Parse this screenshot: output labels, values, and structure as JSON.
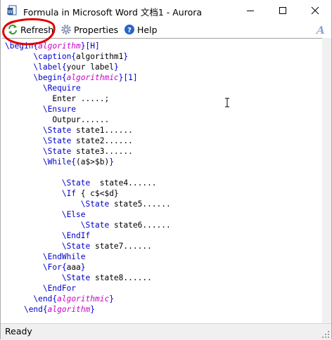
{
  "window": {
    "title": "Formula in Microsoft Word 文档1 - Aurora"
  },
  "toolbar": {
    "refresh_label": "Refresh",
    "properties_label": "Properties",
    "help_label": "Help"
  },
  "editor": {
    "lines": [
      [
        {
          "t": "kw",
          "v": "\\begin{"
        },
        {
          "t": "env",
          "v": "algorithm"
        },
        {
          "t": "kw",
          "v": "}[H]"
        }
      ],
      [
        {
          "t": "txt",
          "v": "      "
        },
        {
          "t": "kw",
          "v": "\\caption{"
        },
        {
          "t": "txt",
          "v": "algorithm1"
        },
        {
          "t": "kw",
          "v": "}"
        }
      ],
      [
        {
          "t": "txt",
          "v": "      "
        },
        {
          "t": "kw",
          "v": "\\label{"
        },
        {
          "t": "txt",
          "v": "your label"
        },
        {
          "t": "kw",
          "v": "}"
        }
      ],
      [
        {
          "t": "txt",
          "v": "      "
        },
        {
          "t": "kw",
          "v": "\\begin{"
        },
        {
          "t": "env",
          "v": "algorithmic"
        },
        {
          "t": "kw",
          "v": "}[1]"
        }
      ],
      [
        {
          "t": "txt",
          "v": "        "
        },
        {
          "t": "kw",
          "v": "\\Require"
        }
      ],
      [
        {
          "t": "txt",
          "v": "          Enter .....;"
        }
      ],
      [
        {
          "t": "txt",
          "v": "        "
        },
        {
          "t": "kw",
          "v": "\\Ensure"
        }
      ],
      [
        {
          "t": "txt",
          "v": "          Outpur......"
        }
      ],
      [
        {
          "t": "txt",
          "v": "        "
        },
        {
          "t": "kw",
          "v": "\\State"
        },
        {
          "t": "txt",
          "v": " state1......"
        }
      ],
      [
        {
          "t": "txt",
          "v": "        "
        },
        {
          "t": "kw",
          "v": "\\State"
        },
        {
          "t": "txt",
          "v": " state2......"
        }
      ],
      [
        {
          "t": "txt",
          "v": "        "
        },
        {
          "t": "kw",
          "v": "\\State"
        },
        {
          "t": "txt",
          "v": " state3......"
        }
      ],
      [
        {
          "t": "txt",
          "v": "        "
        },
        {
          "t": "kw",
          "v": "\\While{"
        },
        {
          "t": "txt",
          "v": "(a$>$b)"
        },
        {
          "t": "kw",
          "v": "}"
        }
      ],
      [
        {
          "t": "txt",
          "v": ""
        }
      ],
      [
        {
          "t": "txt",
          "v": "            "
        },
        {
          "t": "kw",
          "v": "\\State"
        },
        {
          "t": "txt",
          "v": "  state4......"
        }
      ],
      [
        {
          "t": "txt",
          "v": "            "
        },
        {
          "t": "kw",
          "v": "\\If"
        },
        {
          "t": "txt",
          "v": " { c$<$d}"
        }
      ],
      [
        {
          "t": "txt",
          "v": "                "
        },
        {
          "t": "kw",
          "v": "\\State"
        },
        {
          "t": "txt",
          "v": " state5......"
        }
      ],
      [
        {
          "t": "txt",
          "v": "            "
        },
        {
          "t": "kw",
          "v": "\\Else"
        }
      ],
      [
        {
          "t": "txt",
          "v": "                "
        },
        {
          "t": "kw",
          "v": "\\State"
        },
        {
          "t": "txt",
          "v": " state6......"
        }
      ],
      [
        {
          "t": "txt",
          "v": "            "
        },
        {
          "t": "kw",
          "v": "\\EndIf"
        }
      ],
      [
        {
          "t": "txt",
          "v": "            "
        },
        {
          "t": "kw",
          "v": "\\State"
        },
        {
          "t": "txt",
          "v": " state7......"
        }
      ],
      [
        {
          "t": "txt",
          "v": "        "
        },
        {
          "t": "kw",
          "v": "\\EndWhile"
        }
      ],
      [
        {
          "t": "txt",
          "v": "        "
        },
        {
          "t": "kw",
          "v": "\\For{"
        },
        {
          "t": "txt",
          "v": "aaa"
        },
        {
          "t": "kw",
          "v": "}"
        }
      ],
      [
        {
          "t": "txt",
          "v": "            "
        },
        {
          "t": "kw",
          "v": "\\State"
        },
        {
          "t": "txt",
          "v": " state8......"
        }
      ],
      [
        {
          "t": "txt",
          "v": "        "
        },
        {
          "t": "kw",
          "v": "\\EndFor"
        }
      ],
      [
        {
          "t": "txt",
          "v": "      "
        },
        {
          "t": "kw",
          "v": "\\end{"
        },
        {
          "t": "env",
          "v": "algorithmic"
        },
        {
          "t": "kw",
          "v": "}"
        }
      ],
      [
        {
          "t": "txt",
          "v": "    "
        },
        {
          "t": "kw",
          "v": "\\end{"
        },
        {
          "t": "env",
          "v": "algorithm"
        },
        {
          "t": "kw",
          "v": "}"
        }
      ]
    ]
  },
  "status": {
    "text": "Ready"
  },
  "colors": {
    "keyword": "#0000cc",
    "environment": "#cc00cc",
    "annotation": "#e00000"
  },
  "icons": {
    "app": "word-document-icon",
    "refresh": "refresh-icon",
    "properties": "gear-icon",
    "help": "help-icon",
    "italic": "italic-a-icon"
  }
}
